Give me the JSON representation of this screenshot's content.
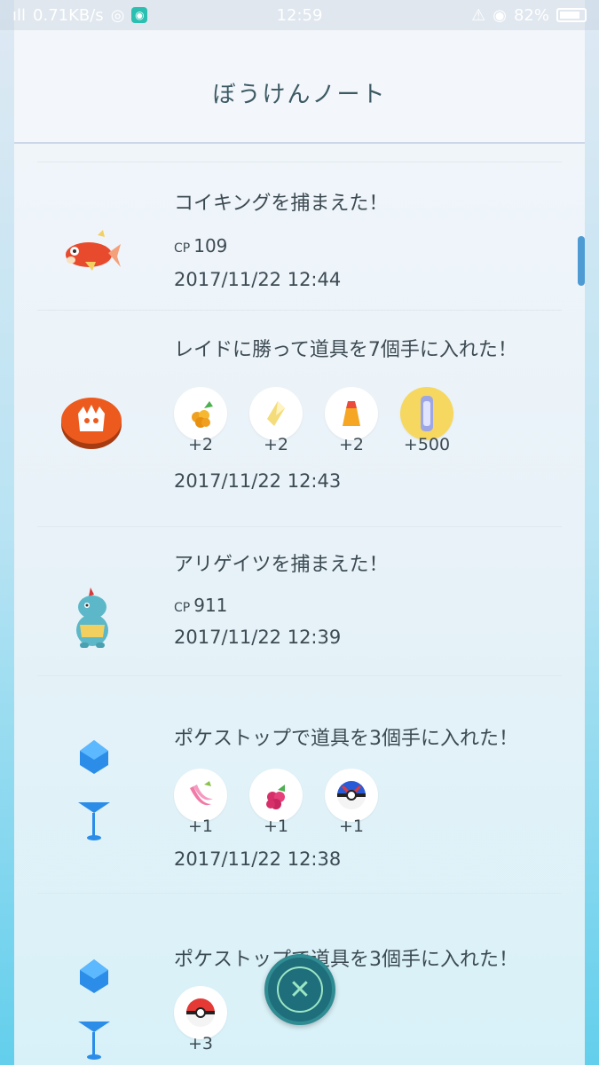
{
  "status_bar": {
    "network_speed": "0.71KB/s",
    "time": "12:59",
    "battery": "82%"
  },
  "header": {
    "title": "ぼうけんノート"
  },
  "entries": [
    {
      "title": "コイキングを捕まえた！",
      "cp_label": "CP",
      "cp_value": "109",
      "time": "2017/11/22 12:44",
      "icon": "magikarp-icon"
    },
    {
      "title": "レイドに勝って道具を7個手に入れた！",
      "time": "2017/11/22 12:43",
      "icon": "raid-badge-icon",
      "items": [
        {
          "icon": "golden-razz-berry-icon",
          "count": "+2"
        },
        {
          "icon": "rare-candy-icon",
          "count": "+2"
        },
        {
          "icon": "tm-icon",
          "count": "+2"
        },
        {
          "icon": "stardust-icon",
          "count": "+500"
        }
      ]
    },
    {
      "title": "アリゲイツを捕まえた！",
      "cp_label": "CP",
      "cp_value": "911",
      "time": "2017/11/22 12:39",
      "icon": "croconaw-icon"
    },
    {
      "title": "ポケストップで道具を3個手に入れた！",
      "time": "2017/11/22 12:38",
      "icon": "pokestop-icon",
      "items": [
        {
          "icon": "nanab-berry-icon",
          "count": "+1"
        },
        {
          "icon": "razz-berry-icon",
          "count": "+1"
        },
        {
          "icon": "great-ball-icon",
          "count": "+1"
        }
      ]
    },
    {
      "title": "ポケストップで道具を3個手に入れた！",
      "icon": "pokestop-icon",
      "items": [
        {
          "icon": "poke-ball-icon",
          "count": "+3"
        }
      ]
    }
  ],
  "close_button": {
    "icon": "close-icon",
    "symbol": "✕"
  },
  "colors": {
    "accent": "#4e9bd4",
    "fab": "#1f6e7b"
  }
}
